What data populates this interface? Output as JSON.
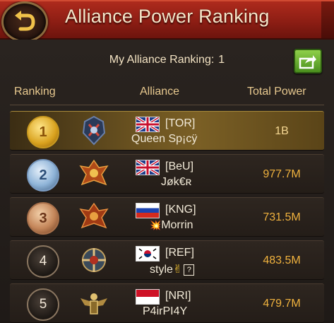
{
  "header": {
    "title": "Alliance Power Ranking",
    "back_icon": "back-arrow-icon"
  },
  "my_ranking": {
    "label": "My Alliance Ranking:",
    "value": "1",
    "share_icon": "share-icon"
  },
  "columns": {
    "ranking": "Ranking",
    "alliance": "Alliance",
    "total_power": "Total Power"
  },
  "rows": [
    {
      "rank": "1",
      "medal": "gold",
      "tag": "[TOR]",
      "name": "Queen Sp¡cÿ",
      "power": "1B",
      "flag": "uk"
    },
    {
      "rank": "2",
      "medal": "silver",
      "tag": "[BeU]",
      "name": "Jøk€ʀ",
      "power": "977.7M",
      "flag": "uk"
    },
    {
      "rank": "3",
      "medal": "bronze",
      "tag": "[KNG]",
      "name": "Morrin",
      "name_prefix": "💥",
      "power": "731.5M",
      "flag": "russia"
    },
    {
      "rank": "4",
      "medal": "plain",
      "tag": "[REF]",
      "name": "style",
      "name_suffix": "✌",
      "name_box": "?",
      "power": "483.5M",
      "flag": "korea"
    },
    {
      "rank": "5",
      "medal": "plain",
      "tag": "[NRI]",
      "name": "P4irPI4Y",
      "power": "479.7M",
      "flag": "indonesia"
    }
  ],
  "colors": {
    "header_red": "#9e2417",
    "gold_text": "#f0b23e",
    "column_header": "#e8c98f"
  }
}
